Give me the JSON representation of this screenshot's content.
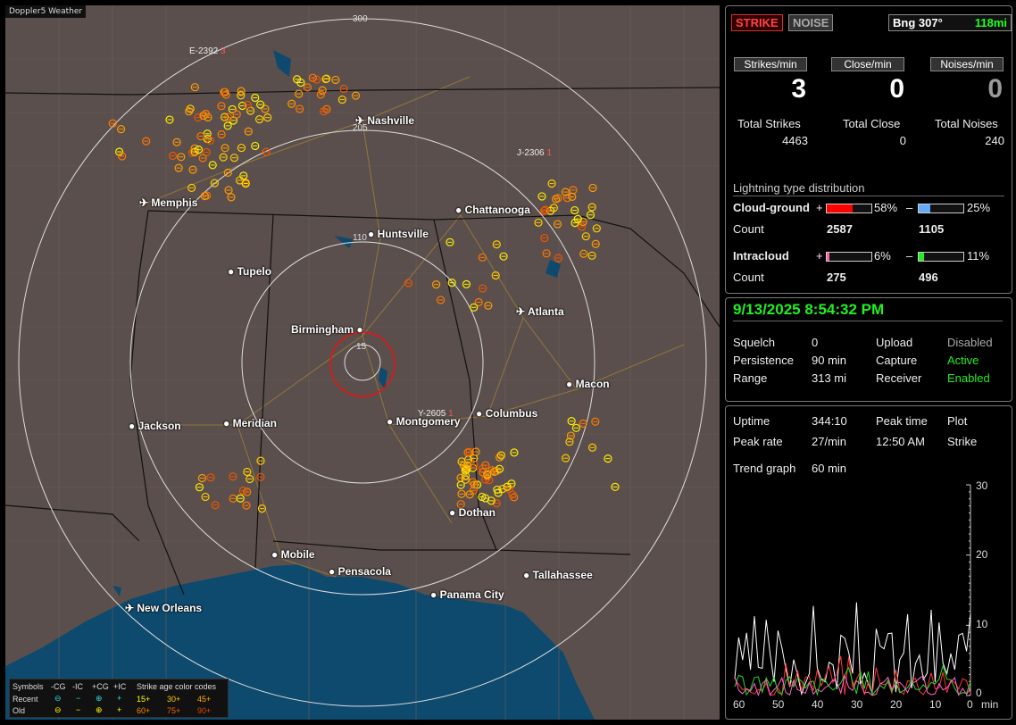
{
  "app": {
    "title": "Doppler5 Weather"
  },
  "map": {
    "ring_labels": [
      "300",
      "205",
      "110",
      "15"
    ],
    "cities": [
      {
        "name": "Nashville",
        "icon": "airport-icon"
      },
      {
        "name": "Memphis",
        "icon": "airport-icon"
      },
      {
        "name": "Chattanooga",
        "icon": "city-dot-icon"
      },
      {
        "name": "Huntsville",
        "icon": "city-dot-icon"
      },
      {
        "name": "Tupelo",
        "icon": "city-dot-icon"
      },
      {
        "name": "Atlanta",
        "icon": "airport-icon"
      },
      {
        "name": "Birmingham",
        "icon": "city-dot-icon"
      },
      {
        "name": "Macon",
        "icon": "city-dot-icon"
      },
      {
        "name": "Columbus",
        "icon": "city-dot-icon"
      },
      {
        "name": "Montgomery",
        "icon": "city-dot-icon"
      },
      {
        "name": "Jackson",
        "icon": "city-dot-icon"
      },
      {
        "name": "Meridian",
        "icon": "city-dot-icon"
      },
      {
        "name": "Dothan",
        "icon": "city-dot-icon"
      },
      {
        "name": "Mobile",
        "icon": "city-dot-icon"
      },
      {
        "name": "Pensacola",
        "icon": "city-dot-icon"
      },
      {
        "name": "Tallahassee",
        "icon": "city-dot-icon"
      },
      {
        "name": "Panama City",
        "icon": "city-dot-icon"
      },
      {
        "name": "New Orleans",
        "icon": "airport-icon"
      }
    ],
    "storm_ids": [
      "E-2392",
      "J-2306",
      "Y-2605"
    ],
    "storm_id_suffix": [
      "3",
      "1",
      "1"
    ]
  },
  "legend": {
    "symbols_label": "Symbols",
    "columns": [
      "-CG",
      "-IC",
      "+CG",
      "+IC"
    ],
    "recent_label": "Recent",
    "old_label": "Old",
    "age_title": "Strike age color codes",
    "recent_ages": [
      "15+",
      "30+",
      "45+"
    ],
    "old_ages": [
      "60+",
      "75+",
      "90+"
    ]
  },
  "status": {
    "strike_label": "STRIKE",
    "noise_label": "NOISE",
    "bearing": "Bng 307°",
    "distance": "118mi"
  },
  "rates": {
    "strikes_label": "Strikes/min",
    "strikes_value": "3",
    "close_label": "Close/min",
    "close_value": "0",
    "noises_label": "Noises/min",
    "noises_value": "0"
  },
  "totals": {
    "strikes_label": "Total Strikes",
    "strikes_value": "4463",
    "close_label": "Total Close",
    "close_value": "0",
    "noises_label": "Total Noises",
    "noises_value": "240"
  },
  "distribution": {
    "title": "Lightning type distribution",
    "cg_label": "Cloud-ground",
    "ic_label": "Intracloud",
    "count_label": "Count",
    "plus": "+",
    "minus": "–",
    "cg_pos_pct": "58%",
    "cg_pos_frac": 0.58,
    "cg_pos_count": "2587",
    "cg_neg_pct": "25%",
    "cg_neg_frac": 0.25,
    "cg_neg_count": "1105",
    "ic_pos_pct": "6%",
    "ic_pos_frac": 0.06,
    "ic_pos_count": "275",
    "ic_neg_pct": "11%",
    "ic_neg_frac": 0.11,
    "ic_neg_count": "496",
    "colors": {
      "cg_pos": "#ff0000",
      "cg_neg": "#66aaff",
      "ic_pos": "#ff66aa",
      "ic_neg": "#22ee22"
    }
  },
  "clock": {
    "datetime": "9/13/2025 8:54:32 PM"
  },
  "settings": {
    "squelch_label": "Squelch",
    "squelch_value": "0",
    "persistence_label": "Persistence",
    "persistence_value": "90 min",
    "range_label": "Range",
    "range_value": "313 mi",
    "upload_label": "Upload",
    "upload_value": "Disabled",
    "capture_label": "Capture",
    "capture_value": "Active",
    "receiver_label": "Receiver",
    "receiver_value": "Enabled"
  },
  "stats": {
    "uptime_label": "Uptime",
    "uptime_value": "344:10",
    "peak_time_label": "Peak time",
    "peak_time_value": "12:50 AM",
    "plot_label": "Plot",
    "plot_value": "Strike",
    "peak_rate_label": "Peak rate",
    "peak_rate_value": "27/min",
    "trend_label": "Trend graph",
    "trend_value": "60 min"
  },
  "trend": {
    "y_ticks": [
      "30",
      "20",
      "10",
      "0"
    ],
    "x_ticks": [
      "60",
      "50",
      "40",
      "30",
      "20",
      "10",
      "0"
    ],
    "x_unit": "min",
    "y_max": 30
  }
}
